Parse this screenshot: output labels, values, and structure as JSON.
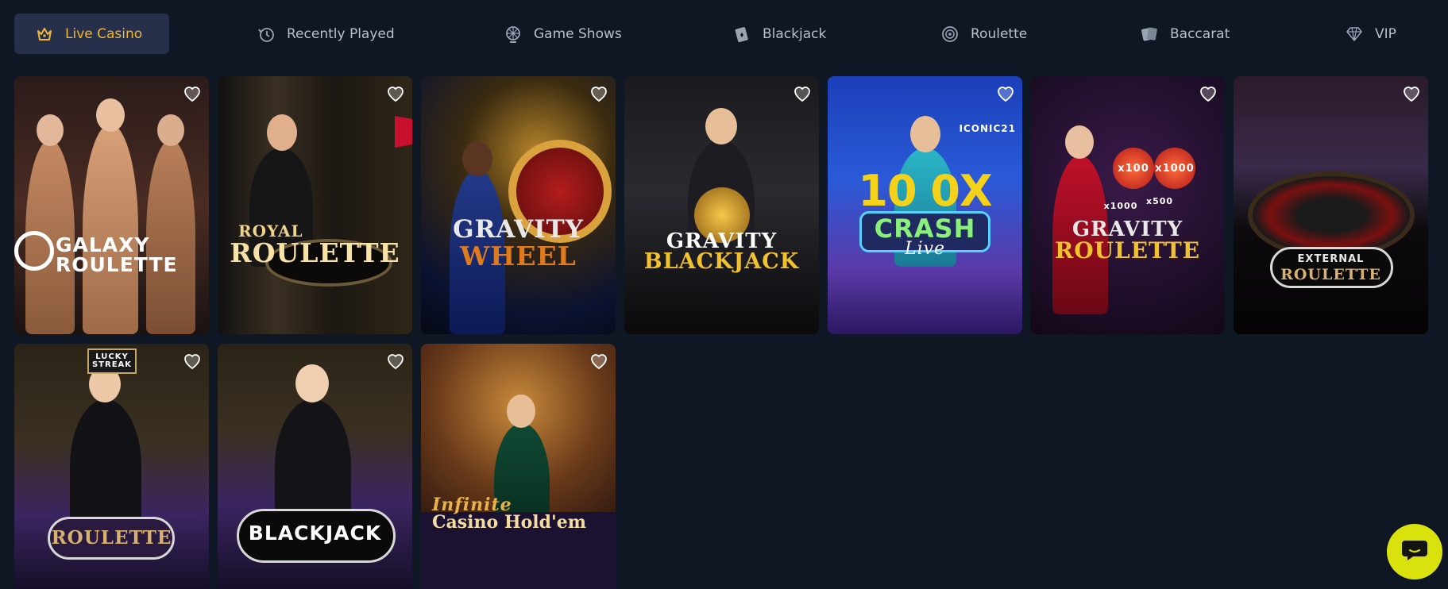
{
  "nav": {
    "categories": [
      {
        "label": "Live Casino",
        "icon": "crown-icon",
        "active": true
      },
      {
        "label": "Recently Played",
        "icon": "history-icon",
        "active": false
      },
      {
        "label": "Game Shows",
        "icon": "wheel-icon",
        "active": false
      },
      {
        "label": "Blackjack",
        "icon": "card-icon",
        "active": false
      },
      {
        "label": "Roulette",
        "icon": "roulette-icon",
        "active": false
      },
      {
        "label": "Baccarat",
        "icon": "cards-icon",
        "active": false
      },
      {
        "label": "VIP",
        "icon": "diamond-icon",
        "active": false
      }
    ]
  },
  "games": [
    {
      "title_line1": "GALAXY",
      "title_line2": "ROULETTE"
    },
    {
      "title_line1": "ROYAL",
      "title_line2": "ROULETTE"
    },
    {
      "title_line1": "GRAVITY",
      "title_line2": "WHEEL"
    },
    {
      "title_line1": "GRAVITY",
      "title_line2": "BLACKJACK"
    },
    {
      "title_line1": "CRASH",
      "title_line2": "Live",
      "top_text": "10 0X",
      "brand": "ICONIC21"
    },
    {
      "title_line1": "GRAVITY",
      "title_line2": "ROULETTE",
      "multipliers": [
        "x100",
        "x1000",
        "x1000",
        "x500"
      ]
    },
    {
      "title_line1": "EXTERNAL",
      "title_line2": "ROULETTE"
    },
    {
      "title_line1": "LUCKY STREAK",
      "title_line2": "ROULETTE"
    },
    {
      "title_line1": "BLACKJACK",
      "title_line2": ""
    },
    {
      "title_line1": "Infinite",
      "title_line2": "Casino Hold'em"
    }
  ],
  "colors": {
    "background": "#0f1624",
    "active_tab_bg": "#26304a",
    "accent": "#f2b534",
    "chat_button": "#d9e20d"
  }
}
